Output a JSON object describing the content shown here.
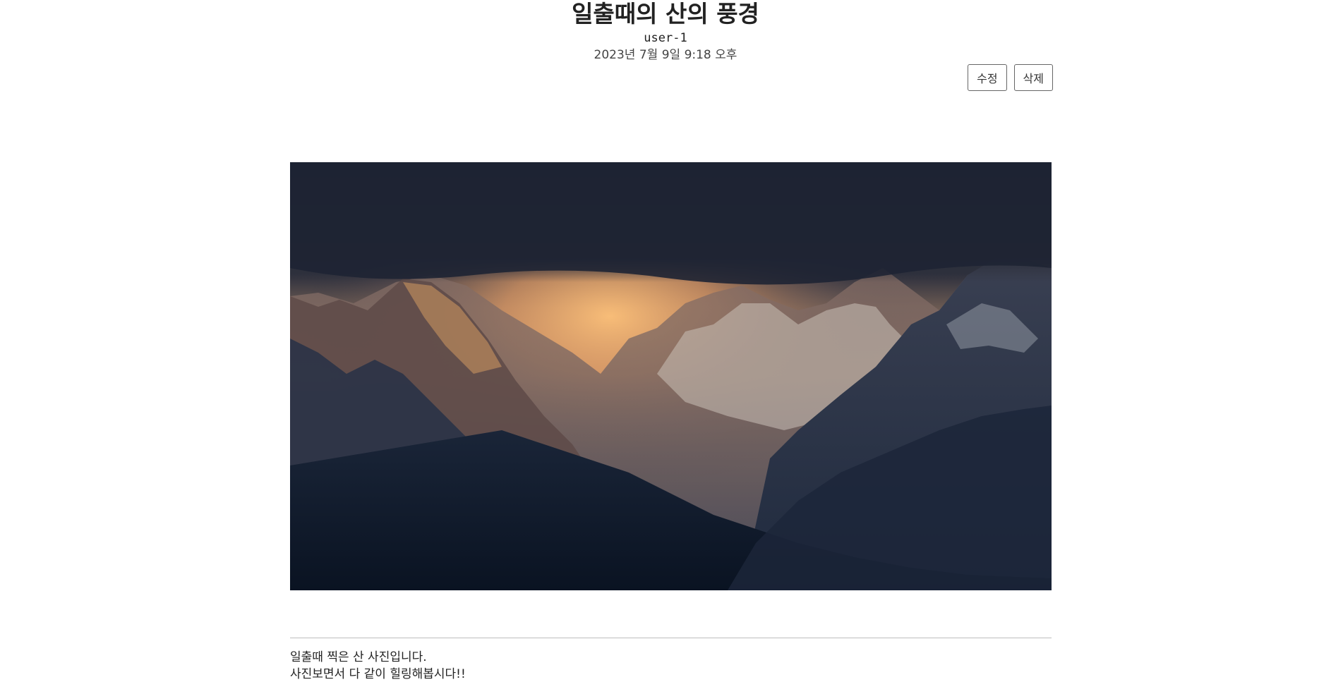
{
  "post": {
    "title": "일출때의 산의 풍경",
    "author": "user-1",
    "date": "2023년 7월 9일 9:18 오후",
    "edit_label": "수정",
    "delete_label": "삭제",
    "body_lines": [
      "일출때 찍은 산 사진입니다.",
      "사진보면서 다 같이 힐링해봅시다!!"
    ]
  },
  "colors": {
    "sky_dark": "#1d2334",
    "glow": "#f2b06a",
    "mountain_dark": "#0f1a2c",
    "snow": "#d8d2cc"
  }
}
